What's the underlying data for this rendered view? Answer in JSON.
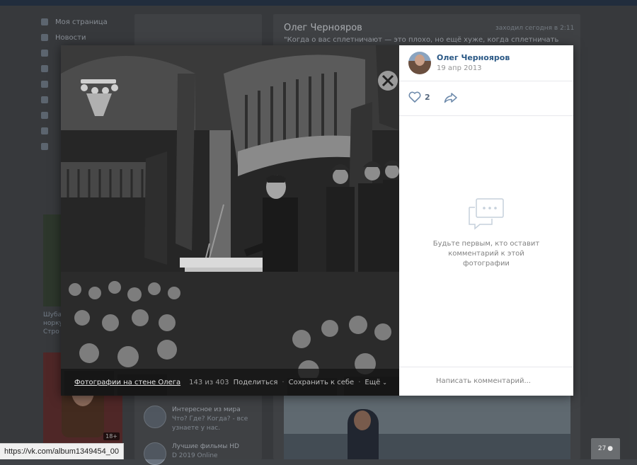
{
  "background": {
    "nav": [
      "Моя страница",
      "Новости"
    ],
    "post_author": "Олег Чернояров",
    "post_meta": "заходил сегодня в 2:11",
    "post_quote": "\"Когда о вас сплетничают — это плохо, но ещё хуже, когда сплетничать",
    "left_text": [
      "Шуба",
      "норку",
      "Стро"
    ],
    "left_photo_badge": "18+",
    "groups": [
      {
        "title": "Интересное из мира",
        "line2": "Что? Где? Когда? - все",
        "line3": "узнаете у нас."
      },
      {
        "title": "Лучшие фильмы HD",
        "line2": "D 2019 Online",
        "line3": ""
      }
    ]
  },
  "viewer": {
    "author_name": "Олег Чернояров",
    "date": "19 апр 2013",
    "likes": "2",
    "album_link": "Фотографии на стене Олега",
    "counter": "143 из 403",
    "share": "Поделиться",
    "save": "Сохранить к себе",
    "more": "Ещё",
    "empty_comments": "Будьте первым, кто оставит комментарий к этой фотографии",
    "comment_placeholder": "Написать комментарий..."
  },
  "status_url": "https://vk.com/album1349454_00",
  "online_counter": "27"
}
